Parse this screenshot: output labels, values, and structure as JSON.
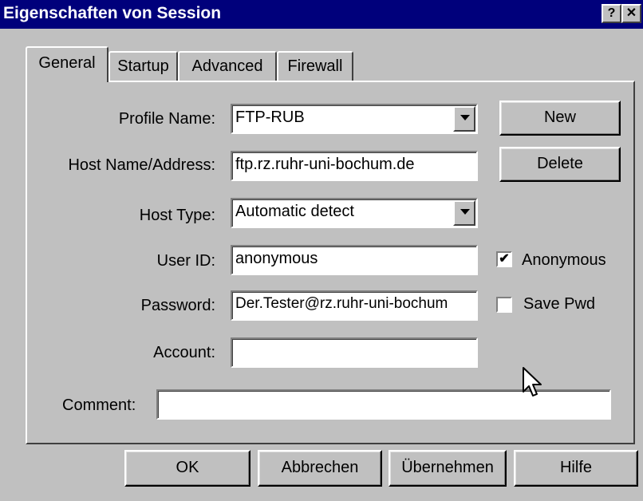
{
  "window": {
    "title": "Eigenschaften von Session",
    "help_button": "?",
    "close_button": "✕"
  },
  "tabs": [
    {
      "label": "General",
      "active": true
    },
    {
      "label": "Startup"
    },
    {
      "label": "Advanced"
    },
    {
      "label": "Firewall"
    }
  ],
  "form": {
    "profile_name": {
      "label": "Profile Name:",
      "value": "FTP-RUB"
    },
    "host_name": {
      "label": "Host Name/Address:",
      "value": "ftp.rz.ruhr-uni-bochum.de"
    },
    "host_type": {
      "label": "Host Type:",
      "value": "Automatic detect"
    },
    "user_id": {
      "label": "User ID:",
      "value": "anonymous"
    },
    "password": {
      "label": "Password:",
      "value": "Der.Tester@rz.ruhr-uni-bochum"
    },
    "account": {
      "label": "Account:",
      "value": ""
    },
    "comment": {
      "label": "Comment:",
      "value": ""
    }
  },
  "side_buttons": {
    "new": "New",
    "delete": "Delete"
  },
  "checkboxes": {
    "anonymous": {
      "label": "Anonymous",
      "checked": true,
      "mark": "✔"
    },
    "save_pwd": {
      "label": "Save Pwd",
      "checked": false
    }
  },
  "footer": {
    "ok": "OK",
    "cancel": "Abbrechen",
    "apply": "Übernehmen",
    "help": "Hilfe"
  }
}
